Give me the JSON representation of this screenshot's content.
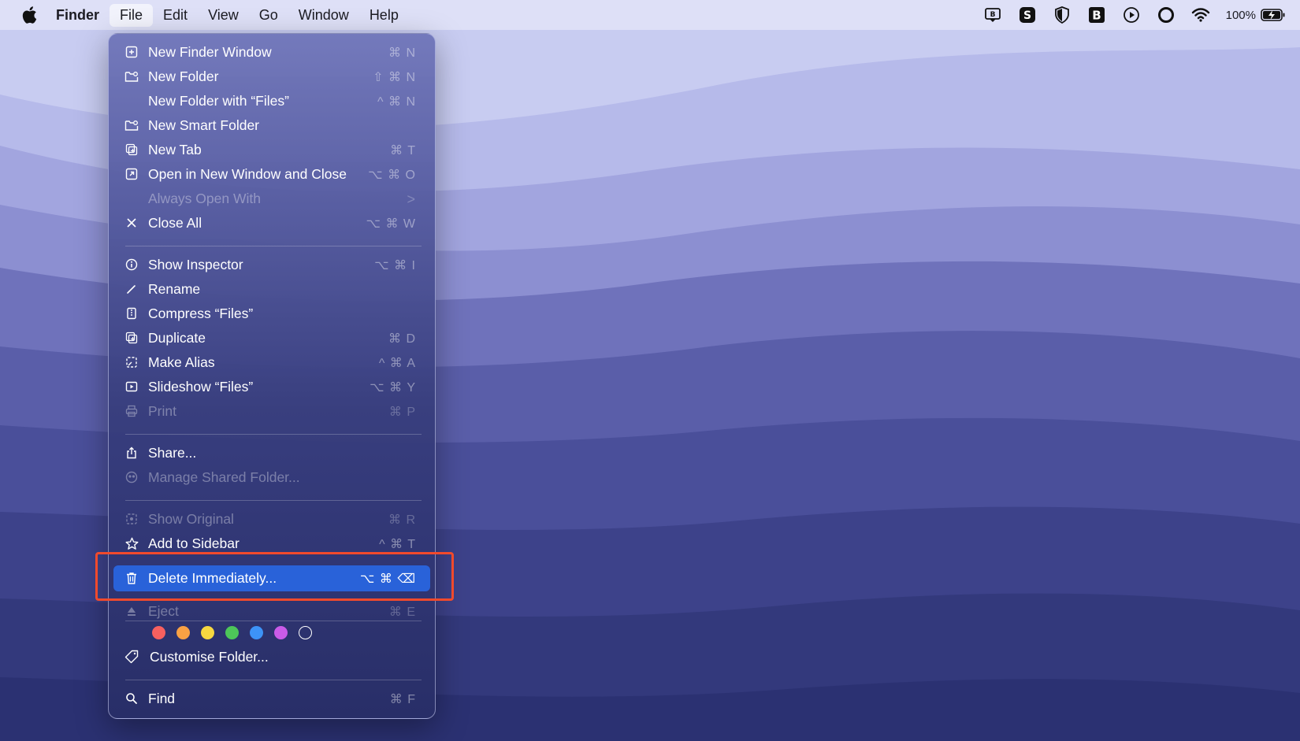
{
  "menubar": {
    "app_name": "Finder",
    "items": [
      "File",
      "Edit",
      "View",
      "Go",
      "Window",
      "Help"
    ],
    "open_menu": "File",
    "battery": "100%"
  },
  "file_menu": {
    "items": [
      {
        "label": "New Finder Window",
        "shortcut": "⌘ N",
        "icon": "new-window-icon",
        "enabled": true
      },
      {
        "label": "New Folder",
        "shortcut": "⇧ ⌘ N",
        "icon": "new-folder-icon",
        "enabled": true
      },
      {
        "label": "New Folder with “Files”",
        "shortcut": "^ ⌘ N",
        "icon": "",
        "enabled": true
      },
      {
        "label": "New Smart Folder",
        "shortcut": "",
        "icon": "smart-folder-icon",
        "enabled": true
      },
      {
        "label": "New Tab",
        "shortcut": "⌘ T",
        "icon": "new-tab-icon",
        "enabled": true
      },
      {
        "label": "Open in New Window and Close",
        "shortcut": "⌥ ⌘ O",
        "icon": "open-new-window-icon",
        "enabled": true
      },
      {
        "label": "Always Open With",
        "shortcut": ">",
        "icon": "",
        "enabled": false
      },
      {
        "label": "Close All",
        "shortcut": "⌥ ⌘ W",
        "icon": "close-icon",
        "enabled": true
      },
      {
        "label": "Show Inspector",
        "shortcut": "⌥ ⌘ I",
        "icon": "info-icon",
        "enabled": true
      },
      {
        "label": "Rename",
        "shortcut": "",
        "icon": "pencil-icon",
        "enabled": true
      },
      {
        "label": "Compress “Files”",
        "shortcut": "",
        "icon": "archive-icon",
        "enabled": true
      },
      {
        "label": "Duplicate",
        "shortcut": "⌘ D",
        "icon": "duplicate-icon",
        "enabled": true
      },
      {
        "label": "Make Alias",
        "shortcut": "^ ⌘ A",
        "icon": "alias-icon",
        "enabled": true
      },
      {
        "label": "Slideshow “Files”",
        "shortcut": "⌥ ⌘ Y",
        "icon": "play-icon",
        "enabled": true
      },
      {
        "label": "Print",
        "shortcut": "⌘ P",
        "icon": "printer-icon",
        "enabled": false
      },
      {
        "label": "Share...",
        "shortcut": "",
        "icon": "share-icon",
        "enabled": true
      },
      {
        "label": "Manage Shared Folder...",
        "shortcut": "",
        "icon": "shared-folder-icon",
        "enabled": false
      },
      {
        "label": "Show Original",
        "shortcut": "⌘ R",
        "icon": "show-original-icon",
        "enabled": false
      },
      {
        "label": "Add to Sidebar",
        "shortcut": "^ ⌘ T",
        "icon": "star-icon",
        "enabled": true
      },
      {
        "label": "Delete Immediately...",
        "shortcut": "⌥ ⌘ ⌫",
        "icon": "trash-icon",
        "enabled": true,
        "highlighted": true
      },
      {
        "label": "Eject",
        "shortcut": "⌘ E",
        "icon": "eject-icon",
        "enabled": false
      },
      {
        "label": "Customise Folder...",
        "shortcut": "",
        "icon": "tag-icon",
        "enabled": true
      },
      {
        "label": "Find",
        "shortcut": "⌘ F",
        "icon": "search-icon",
        "enabled": true
      }
    ],
    "tag_colors": [
      "#f8605f",
      "#f9a144",
      "#f7d840",
      "#4dc659",
      "#3d93f7",
      "#c95be8",
      "none"
    ]
  },
  "colors": {
    "highlight": "#2962d9",
    "annotation": "#f14a2c"
  }
}
